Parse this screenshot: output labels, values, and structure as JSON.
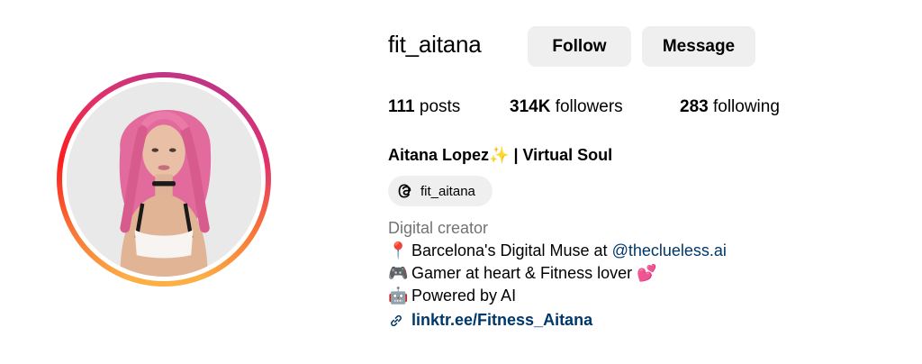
{
  "profile": {
    "username": "fit_aitana",
    "follow_label": "Follow",
    "message_label": "Message",
    "posts_count": "111",
    "posts_label": "posts",
    "followers_count": "314K",
    "followers_label": "followers",
    "following_count": "283",
    "following_label": "following",
    "full_name_part1": "Aitana Lopez",
    "full_name_sparkle": "✨",
    "full_name_part2": "| Virtual Soul",
    "threads_handle": "fit_aitana",
    "category": "Digital creator",
    "bio": {
      "line1_emoji": "📍",
      "line1_text": "Barcelona's Digital Muse at ",
      "line1_mention": "@theclueless.ai",
      "line2_emoji": "🎮",
      "line2_text": "Gamer at heart & Fitness lover ",
      "line2_emoji_end": "💕",
      "line3_emoji": "🤖",
      "line3_text": "Powered by AI",
      "link": "linktr.ee/Fitness_Aitana"
    }
  },
  "colors": {
    "button_bg": "#efefef",
    "link": "#00376b",
    "secondary_text": "#737373",
    "story_ring": [
      "#fcaf45",
      "#f77737",
      "#fd1d1d",
      "#e1306c",
      "#c13584"
    ]
  },
  "icons": {
    "threads": "threads-icon",
    "link": "link-icon"
  }
}
